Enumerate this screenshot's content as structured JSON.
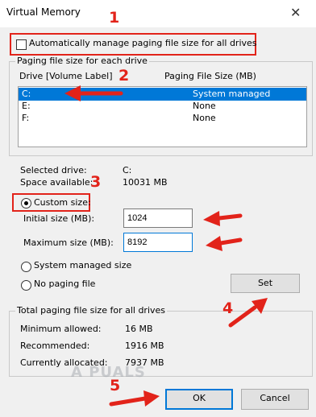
{
  "window": {
    "title": "Virtual Memory",
    "close_glyph": "✕"
  },
  "auto_manage": {
    "label": "Automatically manage paging file size for all drives",
    "checked": false
  },
  "paging_group": {
    "label": "Paging file size for each drive",
    "col_drive": "Drive  [Volume Label]",
    "col_size": "Paging File Size (MB)",
    "rows": [
      {
        "drive": "C:",
        "size": "System managed",
        "selected": true
      },
      {
        "drive": "E:",
        "size": "None",
        "selected": false
      },
      {
        "drive": "F:",
        "size": "None",
        "selected": false
      }
    ]
  },
  "info": {
    "selected_drive_label": "Selected drive:",
    "selected_drive_value": "C:",
    "space_label": "Space available:",
    "space_value": "10031 MB"
  },
  "options": {
    "custom_label": "Custom size:",
    "custom_selected": true,
    "initial_label": "Initial size (MB):",
    "initial_value": "1024",
    "max_label": "Maximum size (MB):",
    "max_value": "8192",
    "system_label": "System managed size",
    "nopaging_label": "No paging file",
    "set_label": "Set"
  },
  "totals": {
    "label": "Total paging file size for all drives",
    "min_label": "Minimum allowed:",
    "min_value": "16 MB",
    "rec_label": "Recommended:",
    "rec_value": "1916 MB",
    "cur_label": "Currently allocated:",
    "cur_value": "7937 MB"
  },
  "buttons": {
    "ok": "OK",
    "cancel": "Cancel"
  },
  "annotations": {
    "n1": "1",
    "n2": "2",
    "n3": "3",
    "n4": "4",
    "n5": "5",
    "color": "#e2231a"
  },
  "watermark": "A PUALS"
}
